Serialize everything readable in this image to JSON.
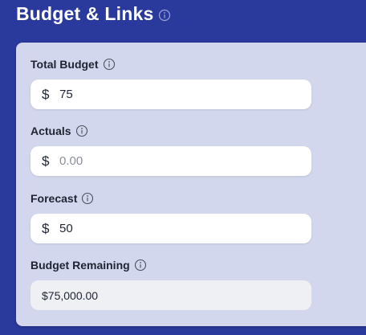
{
  "header": {
    "title": "Budget & Links"
  },
  "fields": {
    "total_budget": {
      "label": "Total Budget",
      "currency": "$",
      "value": "75"
    },
    "actuals": {
      "label": "Actuals",
      "currency": "$",
      "placeholder": "0.00"
    },
    "forecast": {
      "label": "Forecast",
      "currency": "$",
      "value": "50"
    },
    "budget_remaining": {
      "label": "Budget Remaining",
      "value": "$75,000.00"
    }
  },
  "icons": {
    "info": "info-circle-icon"
  },
  "colors": {
    "background": "#2a3a9c",
    "panel": "#d3d7ed",
    "text": "#1f2433"
  }
}
